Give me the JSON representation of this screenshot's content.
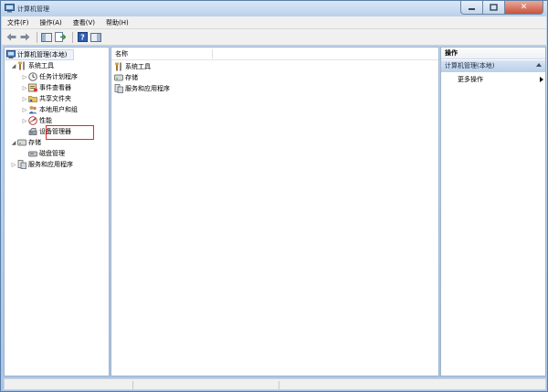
{
  "window": {
    "title": "计算机管理"
  },
  "menu": [
    "文件(F)",
    "操作(A)",
    "查看(V)",
    "帮助(H)"
  ],
  "toolbar": {
    "icons": [
      "back-arrow-icon",
      "forward-arrow-icon",
      "show-hide-tree-icon",
      "export-list-icon",
      "help-icon",
      "show-hide-action-pane-icon"
    ]
  },
  "tree": {
    "root": "计算机管理(本地)",
    "system_tools": "系统工具",
    "task_scheduler": "任务计划程序",
    "event_viewer": "事件查看器",
    "shared_folders": "共享文件夹",
    "local_users": "本地用户和组",
    "performance": "性能",
    "device_manager": "设备管理器",
    "storage": "存储",
    "disk_management": "磁盘管理",
    "services_apps": "服务和应用程序"
  },
  "center": {
    "column_name": "名称",
    "items": [
      "系统工具",
      "存储",
      "服务和应用程序"
    ]
  },
  "actions": {
    "header": "操作",
    "section": "计算机管理(本地)",
    "more": "更多操作"
  },
  "colors": {
    "highlight": "#e5252a",
    "accent": "#b9cfea"
  }
}
